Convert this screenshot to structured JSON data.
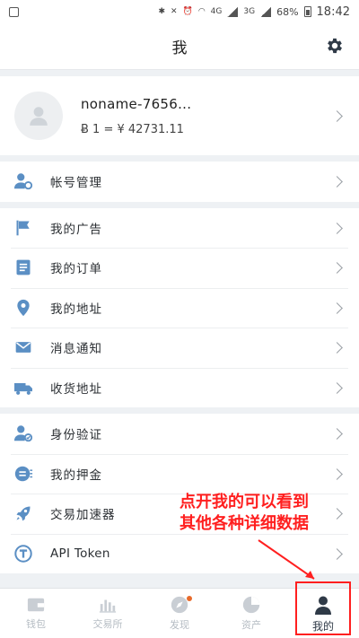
{
  "status_bar": {
    "network_a": "4G",
    "network_b": "3G",
    "battery": "68%",
    "time": "18:42"
  },
  "header": {
    "title": "我"
  },
  "profile": {
    "name": "noname-7656...",
    "rate": "Ƀ 1 = ¥ 42731.11"
  },
  "menu": {
    "account": "帐号管理",
    "ads": "我的广告",
    "orders": "我的订单",
    "address": "我的地址",
    "notify": "消息通知",
    "shipping": "收货地址",
    "identity": "身份验证",
    "deposit": "我的押金",
    "accelerator": "交易加速器",
    "api": "API Token"
  },
  "tabs": {
    "wallet": "钱包",
    "exchange": "交易所",
    "discover": "发现",
    "assets": "资产",
    "mine": "我的"
  },
  "annotation": {
    "line1": "点开我的可以看到",
    "line2": "其他各种详细数据"
  },
  "colors": {
    "accent": "#2f3a47",
    "icon_blue": "#5b8fc4",
    "annotation_red": "#ff1f1f",
    "badge_orange": "#e86a2a"
  }
}
